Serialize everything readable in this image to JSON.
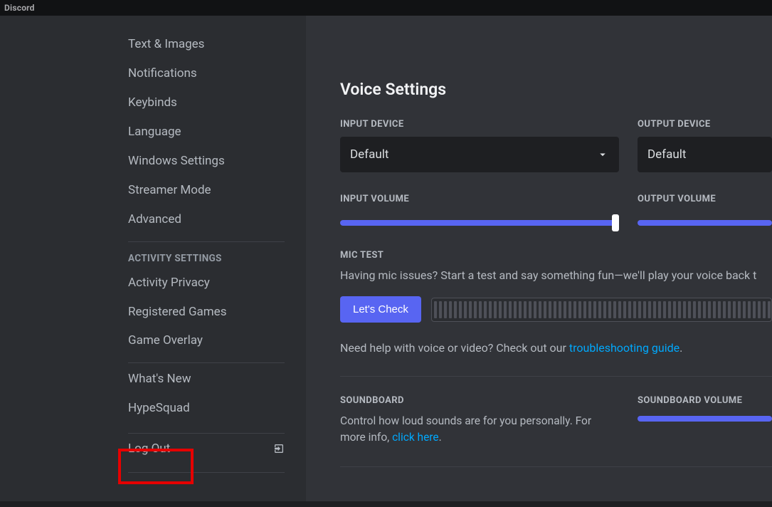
{
  "titlebar": {
    "app": "Discord"
  },
  "sidebar": {
    "items_top": [
      "Text & Images",
      "Notifications",
      "Keybinds",
      "Language",
      "Windows Settings",
      "Streamer Mode",
      "Advanced"
    ],
    "activity_header": "ACTIVITY SETTINGS",
    "items_activity": [
      "Activity Privacy",
      "Registered Games",
      "Game Overlay"
    ],
    "items_misc": [
      "What's New",
      "HypeSquad"
    ],
    "logout": "Log Out"
  },
  "voice": {
    "title": "Voice Settings",
    "input_device_label": "INPUT DEVICE",
    "input_device_value": "Default",
    "output_device_label": "OUTPUT DEVICE",
    "output_device_value": "Default",
    "input_volume_label": "INPUT VOLUME",
    "output_volume_label": "OUTPUT VOLUME",
    "mic_test_label": "MIC TEST",
    "mic_test_desc": "Having mic issues? Start a test and say something fun—we'll play your voice back t",
    "lets_check": "Let's Check",
    "help_prefix": "Need help with voice or video? Check out our ",
    "help_link": "troubleshooting guide",
    "help_suffix": ".",
    "soundboard_label": "SOUNDBOARD",
    "soundboard_desc_prefix": "Control how loud sounds are for you personally. For more info, ",
    "soundboard_link": "click here",
    "soundboard_desc_suffix": ".",
    "soundboard_volume_label": "SOUNDBOARD VOLUME"
  }
}
